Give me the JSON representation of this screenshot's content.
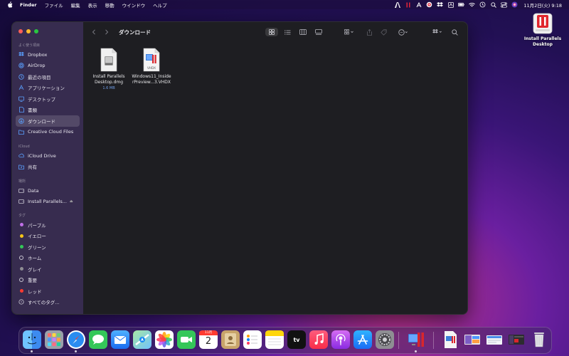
{
  "menubar": {
    "app_name": "Finder",
    "menus": [
      "ファイル",
      "編集",
      "表示",
      "移動",
      "ウインドウ",
      "ヘルプ"
    ],
    "clock": "11月2日(火)  9:18"
  },
  "desktop": {
    "items": [
      {
        "label": "Install Parallels Desktop",
        "icon": "parallels-installer-icon"
      }
    ]
  },
  "finder": {
    "title": "ダウンロード",
    "sidebar": {
      "favorites_header": "よく使う項目",
      "favorites": [
        {
          "label": "Dropbox",
          "icon": "dropbox-icon"
        },
        {
          "label": "AirDrop",
          "icon": "airdrop-icon"
        },
        {
          "label": "最近の項目",
          "icon": "clock-icon"
        },
        {
          "label": "アプリケーション",
          "icon": "applications-icon"
        },
        {
          "label": "デスクトップ",
          "icon": "desktop-icon"
        },
        {
          "label": "書類",
          "icon": "document-icon"
        },
        {
          "label": "ダウンロード",
          "icon": "download-icon",
          "selected": true
        },
        {
          "label": "Creative Cloud Files",
          "icon": "folder-icon"
        }
      ],
      "icloud_header": "iCloud",
      "icloud": [
        {
          "label": "iCloud Drive",
          "icon": "cloud-icon"
        },
        {
          "label": "共有",
          "icon": "shared-folder-icon"
        }
      ],
      "locations_header": "場所",
      "locations": [
        {
          "label": "Data",
          "icon": "disk-icon"
        },
        {
          "label": "Install Parallels...",
          "icon": "disk-icon",
          "eject": "⏏"
        }
      ],
      "tags_header": "タグ",
      "tags": [
        {
          "label": "パープル",
          "color": "#c070e8"
        },
        {
          "label": "イエロー",
          "color": "#f5c518"
        },
        {
          "label": "グリーン",
          "color": "#34c759"
        },
        {
          "label": "ホーム",
          "color": "hollow"
        },
        {
          "label": "グレイ",
          "color": "#8e8e93"
        },
        {
          "label": "重要",
          "color": "hollow"
        },
        {
          "label": "レッド",
          "color": "#ff3b30"
        },
        {
          "label": "すべてのタグ...",
          "color": "all"
        }
      ]
    },
    "files": [
      {
        "name_line1": "Install Parallels",
        "name_line2": "Desktop.dmg",
        "size": "1.6 MB",
        "icon": "dmg-disk-image-icon"
      },
      {
        "name_line1": "Windows11_Inside",
        "name_line2": "rPreview...3.VHDX",
        "size": "",
        "icon": "vhdx-file-icon",
        "badge": "VHDX"
      }
    ]
  },
  "dock": {
    "apps": [
      "Finder",
      "Launchpad",
      "Safari",
      "Messages",
      "Mail",
      "Maps",
      "Photos",
      "FaceTime",
      "Calendar",
      "Contacts",
      "Reminders",
      "Notes",
      "TV",
      "Music",
      "Podcasts",
      "App Store",
      "System Preferences",
      "Parallels Desktop"
    ],
    "calendar_month": "11月",
    "calendar_day": "2",
    "tv_label": "tv",
    "colors": {
      "finder": "#3d8bf0",
      "messages": "#34c759",
      "facetime": "#34c759",
      "music": "#fa3c55",
      "podcasts": "#b150e6",
      "appstore": "#1a8cf5"
    }
  },
  "colors": {
    "close": "#ff5f57",
    "minimize": "#febc2e",
    "zoom": "#28c840",
    "accent": "#6f9fe8"
  }
}
